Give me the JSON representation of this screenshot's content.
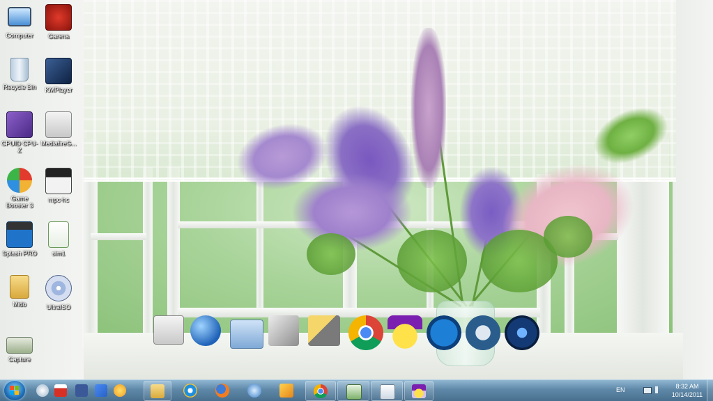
{
  "desktop_icons": [
    {
      "label": "Computer",
      "icon": "computer-icon"
    },
    {
      "label": "Recycle Bin",
      "icon": "recycle-bin-icon"
    },
    {
      "label": "CPUID CPU-Z",
      "icon": "cpuz-icon"
    },
    {
      "label": "Game Booster 3",
      "icon": "game-booster-icon"
    },
    {
      "label": "Splash PRO",
      "icon": "splash-pro-icon"
    },
    {
      "label": "Mido",
      "icon": "folder-icon"
    },
    {
      "label": "Capture",
      "icon": "image-icon"
    },
    {
      "label": "Garena",
      "icon": "garena-icon"
    },
    {
      "label": "KMPlayer",
      "icon": "kmplayer-icon"
    },
    {
      "label": "MediafireG...",
      "icon": "mediafire-icon"
    },
    {
      "label": "mpc-hc",
      "icon": "mpc-hc-icon"
    },
    {
      "label": "sim1",
      "icon": "excel-file-icon"
    },
    {
      "label": "UltraISO",
      "icon": "ultraiso-icon"
    }
  ],
  "dock_items": [
    "preview-icon",
    "network-icon",
    "folder-icon",
    "system-tools-icon",
    "build-tools-icon",
    "chrome-icon",
    "yahoo-messenger-icon",
    "yu-icon",
    "sony-vegas-icon",
    "trillian-icon"
  ],
  "taskbar": {
    "quick_launch": [
      "show-desktop-icon",
      "gmail-icon",
      "facebook-icon",
      "translate-icon",
      "messenger-icon"
    ],
    "pinned": [
      "explorer-icon",
      "internet-explorer-icon",
      "firefox-icon",
      "network-tool-icon",
      "media-player-icon"
    ],
    "running": [
      "chrome-icon",
      "task-manager-icon",
      "window-app-icon",
      "yahoo-messenger-icon"
    ],
    "language": "EN",
    "time": "8:32 AM",
    "date": "10/14/2011"
  },
  "colors": {
    "taskbar_top": "#8fb7d3",
    "taskbar_bottom": "#486f8e",
    "garden_green": "#a9d49a",
    "flower_purple": "#8a6fc4",
    "flower_pink": "#e8b6c4"
  }
}
